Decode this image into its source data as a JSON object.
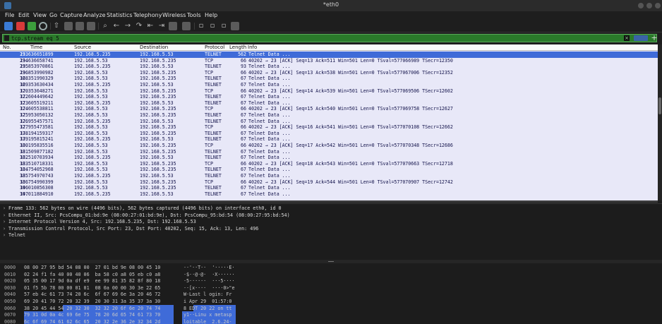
{
  "window": {
    "title": "*eth0"
  },
  "menu": [
    "File",
    "Edit",
    "View",
    "Go",
    "Capture",
    "Analyze",
    "Statistics",
    "Telephony",
    "Wireless",
    "Tools",
    "Help"
  ],
  "filter": {
    "value": "tcp.stream eq 5"
  },
  "columns": [
    "No.",
    "Time",
    "Source",
    "Destination",
    "Protocol",
    "Length",
    "Info"
  ],
  "packets": [
    {
      "no": "133",
      "time": "29.636651899",
      "src": "192.168.5.235",
      "dst": "192.168.5.53",
      "proto": "TELNET",
      "len": "562",
      "info": "Telnet Data ..."
    },
    {
      "no": "134",
      "time": "29.636658741",
      "src": "192.168.5.53",
      "dst": "192.168.5.235",
      "proto": "TCP",
      "len": "66",
      "info": "40202 → 23 [ACK] Seq=13 Ack=511 Win=501 Len=0 TSval=577066989 TSecr=12350"
    },
    {
      "no": "135",
      "time": "29.853970861",
      "src": "192.168.5.235",
      "dst": "192.168.5.53",
      "proto": "TELNET",
      "len": "93",
      "info": "Telnet Data ..."
    },
    {
      "no": "136",
      "time": "29.853990982",
      "src": "192.168.5.53",
      "dst": "192.168.5.235",
      "proto": "TCP",
      "len": "66",
      "info": "40202 → 23 [ACK] Seq=13 Ack=538 Win=501 Len=0 TSval=577067006 TSecr=12352"
    },
    {
      "no": "168",
      "time": "32.351990329",
      "src": "192.168.5.53",
      "dst": "192.168.5.235",
      "proto": "TELNET",
      "len": "67",
      "info": "Telnet Data ..."
    },
    {
      "no": "169",
      "time": "32.353630434",
      "src": "192.168.5.235",
      "dst": "192.168.5.53",
      "proto": "TELNET",
      "len": "67",
      "info": "Telnet Data ..."
    },
    {
      "no": "170",
      "time": "32.353648271",
      "src": "192.168.5.53",
      "dst": "192.168.5.235",
      "proto": "TCP",
      "len": "66",
      "info": "40202 → 23 [ACK] Seq=14 Ack=539 Win=501 Len=0 TSval=577069506 TSecr=12602"
    },
    {
      "no": "172",
      "time": "32.604449642",
      "src": "192.168.5.53",
      "dst": "192.168.5.235",
      "proto": "TELNET",
      "len": "67",
      "info": "Telnet Data ..."
    },
    {
      "no": "173",
      "time": "32.605519211",
      "src": "192.168.5.235",
      "dst": "192.168.5.53",
      "proto": "TELNET",
      "len": "67",
      "info": "Telnet Data ..."
    },
    {
      "no": "174",
      "time": "32.605538811",
      "src": "192.168.5.53",
      "dst": "192.168.5.235",
      "proto": "TCP",
      "len": "66",
      "info": "40202 → 23 [ACK] Seq=15 Ack=540 Win=501 Len=0 TSval=577069758 TSecr=12627"
    },
    {
      "no": "175",
      "time": "32.953050132",
      "src": "192.168.5.53",
      "dst": "192.168.5.235",
      "proto": "TELNET",
      "len": "67",
      "info": "Telnet Data ..."
    },
    {
      "no": "176",
      "time": "32.955457571",
      "src": "192.168.5.235",
      "dst": "192.168.5.53",
      "proto": "TELNET",
      "len": "67",
      "info": "Telnet Data ..."
    },
    {
      "no": "177",
      "time": "32.955473581",
      "src": "192.168.5.53",
      "dst": "192.168.5.235",
      "proto": "TCP",
      "len": "66",
      "info": "40202 → 23 [ACK] Seq=16 Ack=541 Win=501 Len=0 TSval=577070108 TSecr=12662"
    },
    {
      "no": "178",
      "time": "33.194159317",
      "src": "192.168.5.53",
      "dst": "192.168.5.235",
      "proto": "TELNET",
      "len": "67",
      "info": "Telnet Data ..."
    },
    {
      "no": "179",
      "time": "33.195815241",
      "src": "192.168.5.235",
      "dst": "192.168.5.53",
      "proto": "TELNET",
      "len": "67",
      "info": "Telnet Data ..."
    },
    {
      "no": "180",
      "time": "33.195835516",
      "src": "192.168.5.53",
      "dst": "192.168.5.235",
      "proto": "TCP",
      "len": "66",
      "info": "40202 → 23 [ACK] Seq=17 Ack=542 Win=501 Len=0 TSval=577070348 TSecr=12686"
    },
    {
      "no": "181",
      "time": "33.509877182",
      "src": "192.168.5.53",
      "dst": "192.168.5.235",
      "proto": "TELNET",
      "len": "67",
      "info": "Telnet Data ..."
    },
    {
      "no": "182",
      "time": "33.510703934",
      "src": "192.168.5.235",
      "dst": "192.168.5.53",
      "proto": "TELNET",
      "len": "67",
      "info": "Telnet Data ..."
    },
    {
      "no": "183",
      "time": "33.510718331",
      "src": "192.168.5.53",
      "dst": "192.168.5.235",
      "proto": "TCP",
      "len": "66",
      "info": "40202 → 23 [ACK] Seq=18 Ack=543 Win=501 Len=0 TSval=577070663 TSecr=12718"
    },
    {
      "no": "184",
      "time": "33.754052968",
      "src": "192.168.5.53",
      "dst": "192.168.5.235",
      "proto": "TELNET",
      "len": "67",
      "info": "Telnet Data ..."
    },
    {
      "no": "185",
      "time": "33.754970743",
      "src": "192.168.5.235",
      "dst": "192.168.5.53",
      "proto": "TELNET",
      "len": "67",
      "info": "Telnet Data ..."
    },
    {
      "no": "186",
      "time": "33.754990399",
      "src": "192.168.5.53",
      "dst": "192.168.5.235",
      "proto": "TCP",
      "len": "66",
      "info": "40202 → 23 [ACK] Seq=19 Ack=544 Win=501 Len=0 TSval=577070907 TSecr=12742"
    },
    {
      "no": "196",
      "time": "34.010856308",
      "src": "192.168.5.53",
      "dst": "192.168.5.235",
      "proto": "TELNET",
      "len": "67",
      "info": "Telnet Data ..."
    },
    {
      "no": "197",
      "time": "34.011884910",
      "src": "192.168.5.235",
      "dst": "192.168.5.53",
      "proto": "TELNET",
      "len": "67",
      "info": "Telnet Data ..."
    }
  ],
  "details": [
    "Frame 133: 562 bytes on wire (4496 bits), 562 bytes captured (4496 bits) on interface eth0, id 0",
    "Ethernet II, Src: PcsCompu_01:bd:9e (08:00:27:01:bd:9e), Dst: PcsCompu_95:bd:54 (08:00:27:95:bd:54)",
    "Internet Protocol Version 4, Src: 192.168.5.235, Dst: 192.168.5.53",
    "Transmission Control Protocol, Src Port: 23, Dst Port: 40202, Seq: 15, Ack: 13, Len: 496",
    "Telnet"
  ],
  "hex": [
    {
      "off": "0000",
      "bytes": "08 00 27 95 bd 54 08 00  27 01 bd 9e 08 00 45 10",
      "ascii": "··'··T··  '·····E·"
    },
    {
      "off": "0010",
      "bytes": "02 24 f1 fa 40 00 40 06  ba 58 c0 a8 05 eb c0 a8",
      "ascii": "·$··@·@·  ·X······"
    },
    {
      "off": "0020",
      "bytes": "05 35 00 17 9d 0a df e9  ee 99 81 35 82 8f 80 18",
      "ascii": "·5······  ···5····"
    },
    {
      "off": "0030",
      "bytes": "01 f5 5b 78 00 00 01 01  08 0a 00 00 30 3e 22 65",
      "ascii": "··[x····  ····0>\"e"
    },
    {
      "off": "0040",
      "bytes": "57 eb 4c 61 73 74 20 6c  6f 67 69 6e 3a 20 46 72",
      "ascii": "W·Last l ogin: Fr"
    },
    {
      "off": "0050",
      "bytes": "69 20 41 70 72 20 32 39  20 30 31 3a 35 37 3a 30",
      "ascii": "i Apr 29  01:57:0"
    },
    {
      "off": "0060",
      "bytes": "38 20 45 44 54 20 32 30  32 32 20 6f 6e 20 74 74",
      "ascii": "8 EDT 20 22 on tt"
    },
    {
      "off": "0070",
      "bytes": "79 31 0d 0a 4c 69 6e 75  78 20 6d 65 74 61 73 70",
      "ascii": "y1··Linu x metasp"
    },
    {
      "off": "0080",
      "bytes": "6c 6f 69 74 61 62 6c 65  20 32 2e 36 2e 32 34 2d",
      "ascii": "loitable  2.6.24-"
    },
    {
      "off": "0090",
      "bytes": "31 36 2d 73 65 72 76 65  72 20 23 31 20 53 4d 50",
      "ascii": "16-serve r #1 SMP"
    }
  ]
}
